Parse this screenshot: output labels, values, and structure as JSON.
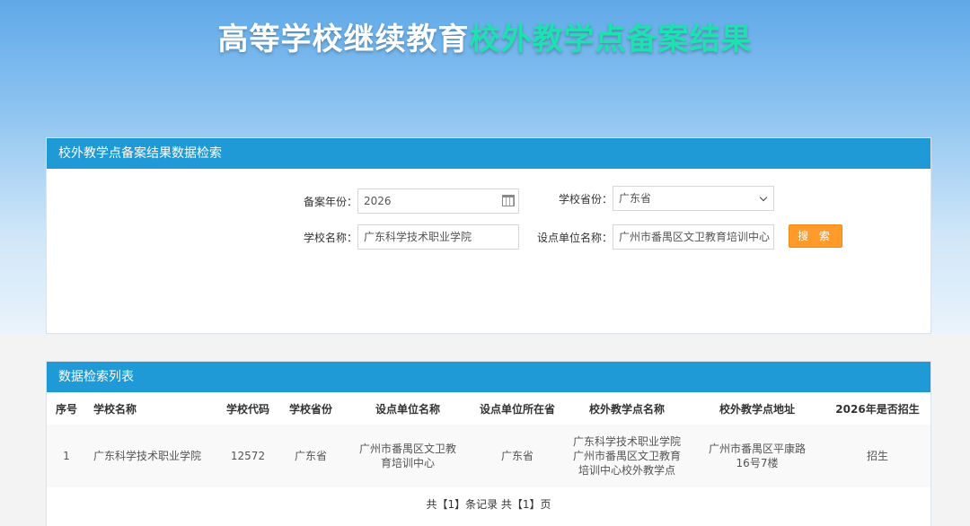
{
  "banner": {
    "title_part1": "高等学校继续教育",
    "title_part2": "校外教学点备案结果"
  },
  "search_panel": {
    "heading": "校外教学点备案结果数据检索",
    "fields": {
      "year": {
        "label": "备案年份：",
        "value": "2026"
      },
      "province": {
        "label": "学校省份：",
        "value": "广东省"
      },
      "school_name": {
        "label": "学校名称：",
        "value": "广东科学技术职业学院"
      },
      "unit_name": {
        "label": "设点单位名称：",
        "value": "广州市番禺区文卫教育培训中心"
      }
    },
    "search_button": "搜 索"
  },
  "results_panel": {
    "heading": "数据检索列表",
    "columns": [
      "序号",
      "学校名称",
      "学校代码",
      "学校省份",
      "设点单位名称",
      "设点单位所在省",
      "校外教学点名称",
      "校外教学点地址",
      "2026年是否招生"
    ],
    "rows": [
      [
        "1",
        "广东科学技术职业学院",
        "12572",
        "广东省",
        "广州市番禺区文卫教育培训中心",
        "广东省",
        "广东科学技术职业学院广州市番禺区文卫教育培训中心校外教学点",
        "广州市番禺区平康路16号7楼",
        "招生"
      ]
    ],
    "pager": "共【1】条记录 共【1】页"
  },
  "icons": {
    "date_picker": "calendar-icon",
    "dropdown": "chevron-down-icon"
  },
  "colors": {
    "header_bar": "#1f9ad6",
    "search_button": "#ff9a2b",
    "title_accent": "#1ee0b0"
  }
}
